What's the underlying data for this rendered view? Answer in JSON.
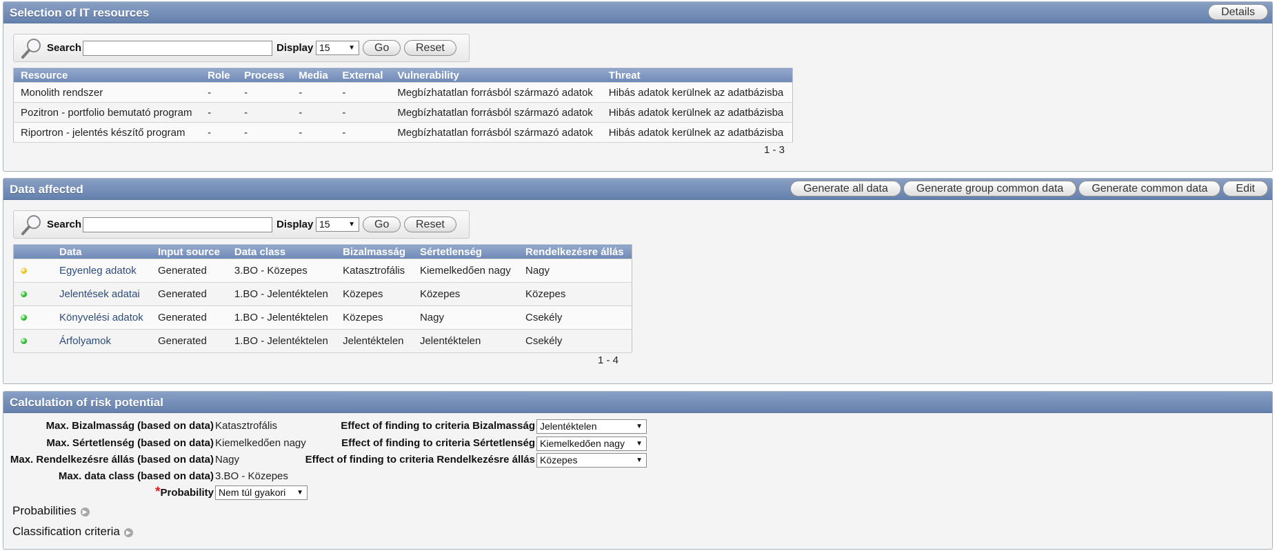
{
  "resources": {
    "title": "Selection of IT resources",
    "details_label": "Details",
    "search": {
      "label": "Search",
      "value": "",
      "display_label": "Display",
      "display_value": "15",
      "go_label": "Go",
      "reset_label": "Reset"
    },
    "columns": [
      "Resource",
      "Role",
      "Process",
      "Media",
      "External",
      "Vulnerability",
      "Threat"
    ],
    "rows": [
      [
        "Monolith rendszer",
        "-",
        "-",
        "-",
        "-",
        "Megbízhatatlan forrásból származó adatok",
        "Hibás adatok kerülnek az adatbázisba"
      ],
      [
        "Pozitron - portfolio bemutató program",
        "-",
        "-",
        "-",
        "-",
        "Megbízhatatlan forrásból származó adatok",
        "Hibás adatok kerülnek az adatbázisba"
      ],
      [
        "Riportron - jelentés készítő program",
        "-",
        "-",
        "-",
        "-",
        "Megbízhatatlan forrásból származó adatok",
        "Hibás adatok kerülnek az adatbázisba"
      ]
    ],
    "pagination": "1 - 3"
  },
  "data_affected": {
    "title": "Data affected",
    "buttons": {
      "generate_all": "Generate all data",
      "generate_group": "Generate group common data",
      "generate_common": "Generate common data",
      "edit": "Edit"
    },
    "search": {
      "label": "Search",
      "value": "",
      "display_label": "Display",
      "display_value": "15",
      "go_label": "Go",
      "reset_label": "Reset"
    },
    "columns": [
      "",
      "Data",
      "Input source",
      "Data class",
      "Bizalmasság",
      "Sértetlenség",
      "Rendelkezésre állás"
    ],
    "rows": [
      {
        "status_color": "#e8c21a",
        "data": "Egyenleg adatok",
        "input_source": "Generated",
        "data_class": "3.BO - Közepes",
        "bizalmassag": "Katasztrofális",
        "sertetlenseg": "Kiemelkedően nagy",
        "rendelkezesre": "Nagy"
      },
      {
        "status_color": "#22bb22",
        "data": "Jelentések adatai",
        "input_source": "Generated",
        "data_class": "1.BO - Jelentéktelen",
        "bizalmassag": "Közepes",
        "sertetlenseg": "Közepes",
        "rendelkezesre": "Közepes"
      },
      {
        "status_color": "#22bb22",
        "data": "Könyvelési adatok",
        "input_source": "Generated",
        "data_class": "1.BO - Jelentéktelen",
        "bizalmassag": "Közepes",
        "sertetlenseg": "Nagy",
        "rendelkezesre": "Csekély"
      },
      {
        "status_color": "#22bb22",
        "data": "Árfolyamok",
        "input_source": "Generated",
        "data_class": "1.BO - Jelentéktelen",
        "bizalmassag": "Jelentéktelen",
        "sertetlenseg": "Jelentéktelen",
        "rendelkezesre": "Csekély"
      }
    ],
    "pagination": "1 - 4"
  },
  "risk": {
    "title": "Calculation of risk potential",
    "max_bizalmassag_label": "Max. Bizalmasság (based on data)",
    "max_bizalmassag_value": "Katasztrofális",
    "max_sertetlenseg_label": "Max. Sértetlenség (based on data)",
    "max_sertetlenseg_value": "Kiemelkedően nagy",
    "max_rendelkezesre_label": "Max. Rendelkezésre állás (based on data)",
    "max_rendelkezesre_value": "Nagy",
    "max_dataclass_label": "Max. data class (based on data)",
    "max_dataclass_value": "3.BO - Közepes",
    "probability_label": "Probability",
    "probability_value": "Nem túl gyakori",
    "effect_bizalmassag_label": "Effect of finding to criteria Bizalmasság",
    "effect_bizalmassag_value": "Jelentéktelen",
    "effect_sertetlenseg_label": "Effect of finding to criteria Sértetlenség",
    "effect_sertetlenseg_value": "Kiemelkedően nagy",
    "effect_rendelkezesre_label": "Effect of finding to criteria Rendelkezésre állás",
    "effect_rendelkezesre_value": "Közepes",
    "probabilities_label": "Probabilities",
    "classification_label": "Classification criteria"
  }
}
